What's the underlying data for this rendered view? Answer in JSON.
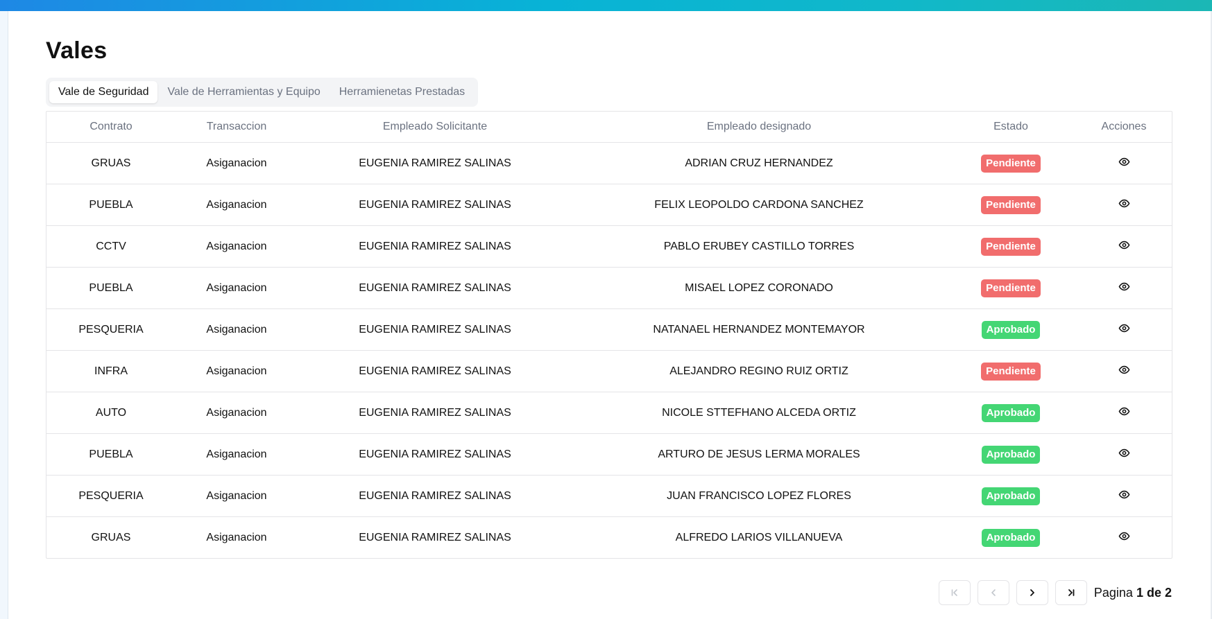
{
  "page": {
    "title": "Vales"
  },
  "tabs": [
    {
      "label": "Vale de Seguridad",
      "active": true
    },
    {
      "label": "Vale de Herramientas y Equipo",
      "active": false
    },
    {
      "label": "Herramienetas Prestadas",
      "active": false
    }
  ],
  "table": {
    "headers": [
      "Contrato",
      "Transaccion",
      "Empleado Solicitante",
      "Empleado designado",
      "Estado",
      "Acciones"
    ],
    "rows": [
      {
        "contrato": "GRUAS",
        "transaccion": "Asiganacion",
        "solicitante": "EUGENIA RAMIREZ SALINAS",
        "designado": "ADRIAN CRUZ HERNANDEZ",
        "estado": "Pendiente"
      },
      {
        "contrato": "PUEBLA",
        "transaccion": "Asiganacion",
        "solicitante": "EUGENIA RAMIREZ SALINAS",
        "designado": "FELIX LEOPOLDO CARDONA SANCHEZ",
        "estado": "Pendiente"
      },
      {
        "contrato": "CCTV",
        "transaccion": "Asiganacion",
        "solicitante": "EUGENIA RAMIREZ SALINAS",
        "designado": "PABLO ERUBEY CASTILLO TORRES",
        "estado": "Pendiente"
      },
      {
        "contrato": "PUEBLA",
        "transaccion": "Asiganacion",
        "solicitante": "EUGENIA RAMIREZ SALINAS",
        "designado": "MISAEL LOPEZ CORONADO",
        "estado": "Pendiente"
      },
      {
        "contrato": "PESQUERIA",
        "transaccion": "Asiganacion",
        "solicitante": "EUGENIA RAMIREZ SALINAS",
        "designado": "NATANAEL HERNANDEZ MONTEMAYOR",
        "estado": "Aprobado"
      },
      {
        "contrato": "INFRA",
        "transaccion": "Asiganacion",
        "solicitante": "EUGENIA RAMIREZ SALINAS",
        "designado": "ALEJANDRO REGINO RUIZ ORTIZ",
        "estado": "Pendiente"
      },
      {
        "contrato": "AUTO",
        "transaccion": "Asiganacion",
        "solicitante": "EUGENIA RAMIREZ SALINAS",
        "designado": "NICOLE STTEFHANO ALCEDA ORTIZ",
        "estado": "Aprobado"
      },
      {
        "contrato": "PUEBLA",
        "transaccion": "Asiganacion",
        "solicitante": "EUGENIA RAMIREZ SALINAS",
        "designado": "ARTURO DE JESUS LERMA MORALES",
        "estado": "Aprobado"
      },
      {
        "contrato": "PESQUERIA",
        "transaccion": "Asiganacion",
        "solicitante": "EUGENIA RAMIREZ SALINAS",
        "designado": "JUAN FRANCISCO LOPEZ FLORES",
        "estado": "Aprobado"
      },
      {
        "contrato": "GRUAS",
        "transaccion": "Asiganacion",
        "solicitante": "EUGENIA RAMIREZ SALINAS",
        "designado": "ALFREDO LARIOS VILLANUEVA",
        "estado": "Aprobado"
      }
    ],
    "action_icon": "eye-icon"
  },
  "pagination": {
    "label": "Pagina",
    "current_of_total": "1 de 2",
    "buttons": [
      "first-page-icon",
      "prev-page-icon",
      "next-page-icon",
      "last-page-icon"
    ]
  },
  "colors": {
    "pending": "#f16d6d",
    "approved": "#44d674",
    "topbar_start": "#1e88e5",
    "topbar_end": "#1bb7b5"
  }
}
